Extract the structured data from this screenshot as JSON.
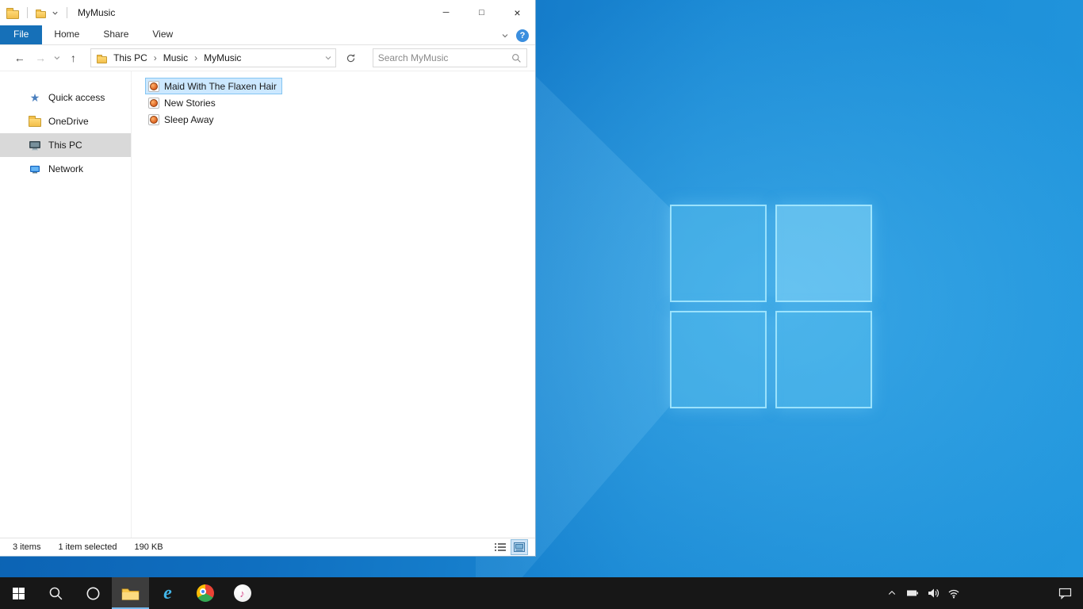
{
  "explorer": {
    "title": "MyMusic",
    "controls": {
      "minimize": "─",
      "maximize": "□",
      "close": "×"
    },
    "ribbon": {
      "tabs": [
        "File",
        "Home",
        "Share",
        "View"
      ],
      "help": "?"
    },
    "nav": {
      "back": "←",
      "forward": "→",
      "up": "↑",
      "separator": "›",
      "breadcrumb": [
        "This PC",
        "Music",
        "MyMusic"
      ],
      "search_placeholder": "Search MyMusic"
    },
    "sidebar": [
      {
        "label": "Quick access"
      },
      {
        "label": "OneDrive"
      },
      {
        "label": "This PC"
      },
      {
        "label": "Network"
      }
    ],
    "files": [
      {
        "name": "Maid With The Flaxen Hair"
      },
      {
        "name": "New Stories"
      },
      {
        "name": "Sleep Away"
      }
    ],
    "status": {
      "count": "3 items",
      "selection": "1 item selected",
      "size": "190 KB"
    }
  },
  "icons": {
    "quick_access_star": "★",
    "itunes_note": "♪",
    "ie_letter": "e"
  },
  "colors": {
    "accent": "#1670b8",
    "selection": "#cce8ff",
    "taskbar": "#171717",
    "wallpaper": "#1b8ad5"
  }
}
